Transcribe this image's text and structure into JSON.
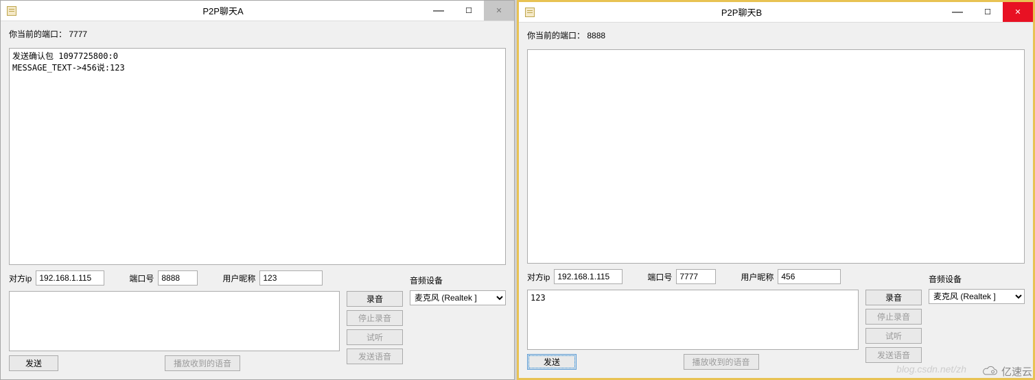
{
  "windowA": {
    "title": "P2P聊天A",
    "port_label": "你当前的端口：",
    "port_value": "7777",
    "log": "发送确认包 1097725800:0\nMESSAGE_TEXT->456说:123",
    "peer_ip_label": "对方ip",
    "peer_ip": "192.168.1.115",
    "peer_port_label": "端口号",
    "peer_port": "8888",
    "nick_label": "用户昵称",
    "nick": "123",
    "msg_input": "",
    "send_btn": "发送",
    "play_received_btn": "播放收到的语音",
    "record_btn": "录音",
    "stop_record_btn": "停止录音",
    "preview_btn": "试听",
    "send_voice_btn": "发送语音",
    "audio_device_label": "音频设备",
    "audio_device": "麦克风 (Realtek ]"
  },
  "windowB": {
    "title": "P2P聊天B",
    "port_label": "你当前的端口：",
    "port_value": "8888",
    "log": "",
    "peer_ip_label": "对方ip",
    "peer_ip": "192.168.1.115",
    "peer_port_label": "端口号",
    "peer_port": "7777",
    "nick_label": "用户昵称",
    "nick": "456",
    "msg_input": "123",
    "send_btn": "发送",
    "play_received_btn": "播放收到的语音",
    "record_btn": "录音",
    "stop_record_btn": "停止录音",
    "preview_btn": "试听",
    "send_voice_btn": "发送语音",
    "audio_device_label": "音频设备",
    "audio_device": "麦克风 (Realtek ]"
  },
  "watermark": "亿速云",
  "url_watermark": "blog.csdn.net/zh"
}
